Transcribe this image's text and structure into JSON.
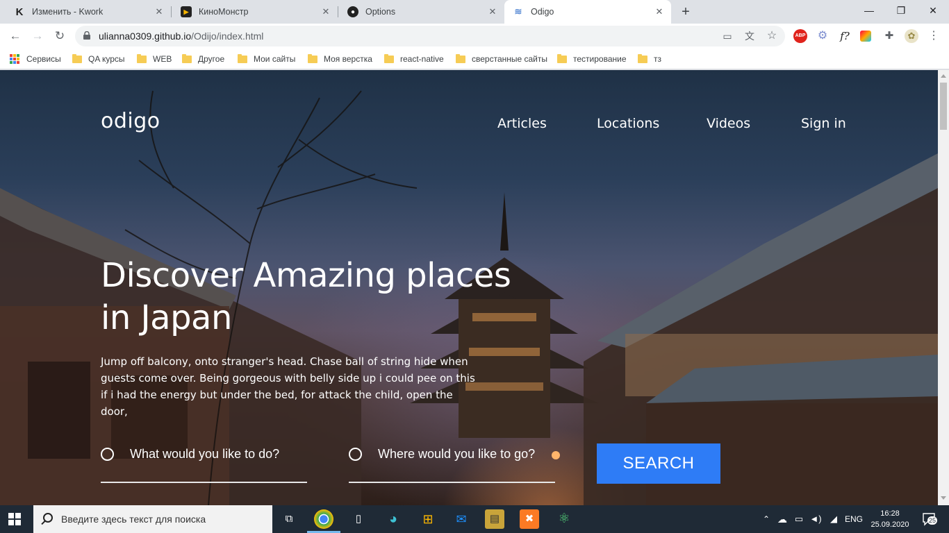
{
  "browser": {
    "tabs": [
      {
        "title": "Изменить - Kwork",
        "favicon": "kwork-icon"
      },
      {
        "title": "КиноМонстр",
        "favicon": "kinomonstr-icon"
      },
      {
        "title": "Options",
        "favicon": "github-icon"
      },
      {
        "title": "Odigo",
        "favicon": "odigo-icon",
        "active": true
      }
    ],
    "new_tab": "+",
    "window_controls": {
      "minimize": "—",
      "maximize": "❐",
      "close": "✕"
    },
    "url": {
      "domain": "ulianna0309.github.io",
      "path": "/Odijo/index.html"
    },
    "extensions": {
      "abp": "ABP",
      "f": "f?"
    }
  },
  "bookmarks": [
    {
      "label": "Сервисы",
      "type": "apps"
    },
    {
      "label": "QA курсы",
      "type": "folder"
    },
    {
      "label": "WEB",
      "type": "folder"
    },
    {
      "label": "Другое",
      "type": "folder"
    },
    {
      "label": "Мои сайты",
      "type": "folder"
    },
    {
      "label": "Моя верстка",
      "type": "folder"
    },
    {
      "label": "react-native",
      "type": "folder"
    },
    {
      "label": "сверстанные сайты",
      "type": "folder"
    },
    {
      "label": "тестирование",
      "type": "folder"
    },
    {
      "label": "тз",
      "type": "folder"
    }
  ],
  "site": {
    "logo": "odigo",
    "nav": [
      "Articles",
      "Locations",
      "Videos",
      "Sign in"
    ],
    "hero": {
      "title": "Discover Amazing places in Japan",
      "text": "Jump off balcony, onto stranger's head. Chase ball of string hide when guests come over. Being gorgeous with belly side up i could pee on this if i had the energy but under the bed, for attack the child, open the door,"
    },
    "search": {
      "what_label": "What would you like to do?",
      "where_label": "Where would you like to go?",
      "button": "SEARCH"
    },
    "colors": {
      "accent": "#2e7cf6"
    }
  },
  "taskbar": {
    "search_placeholder": "Введите здесь текст для поиска",
    "language": "ENG",
    "time": "16:28",
    "date": "25.09.2020",
    "notifications": "25"
  }
}
